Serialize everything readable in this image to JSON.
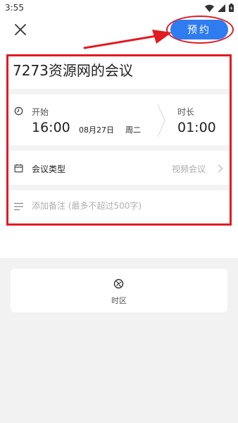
{
  "status_bar": {
    "time": "3:55",
    "icons": [
      "wifi-icon",
      "signal-icon",
      "battery-icon"
    ]
  },
  "header": {
    "close_icon": "close-icon",
    "book_label": "预约"
  },
  "meeting": {
    "title": "7273资源网的会议",
    "start_label": "开始",
    "start_time": "16:00",
    "start_date": "08月27日",
    "start_weekday": "周二",
    "duration_label": "时长",
    "duration_value": "01:00",
    "type_label": "会议类型",
    "type_value": "视频会议",
    "notes_placeholder": "添加备注 (最多不超过500字)",
    "notes_value": ""
  },
  "timezone": {
    "label": "时区",
    "icon": "timezone-icon"
  },
  "colors": {
    "accent": "#2f7bf0",
    "highlight": "#e01b22",
    "background": "#f2f2f2"
  }
}
